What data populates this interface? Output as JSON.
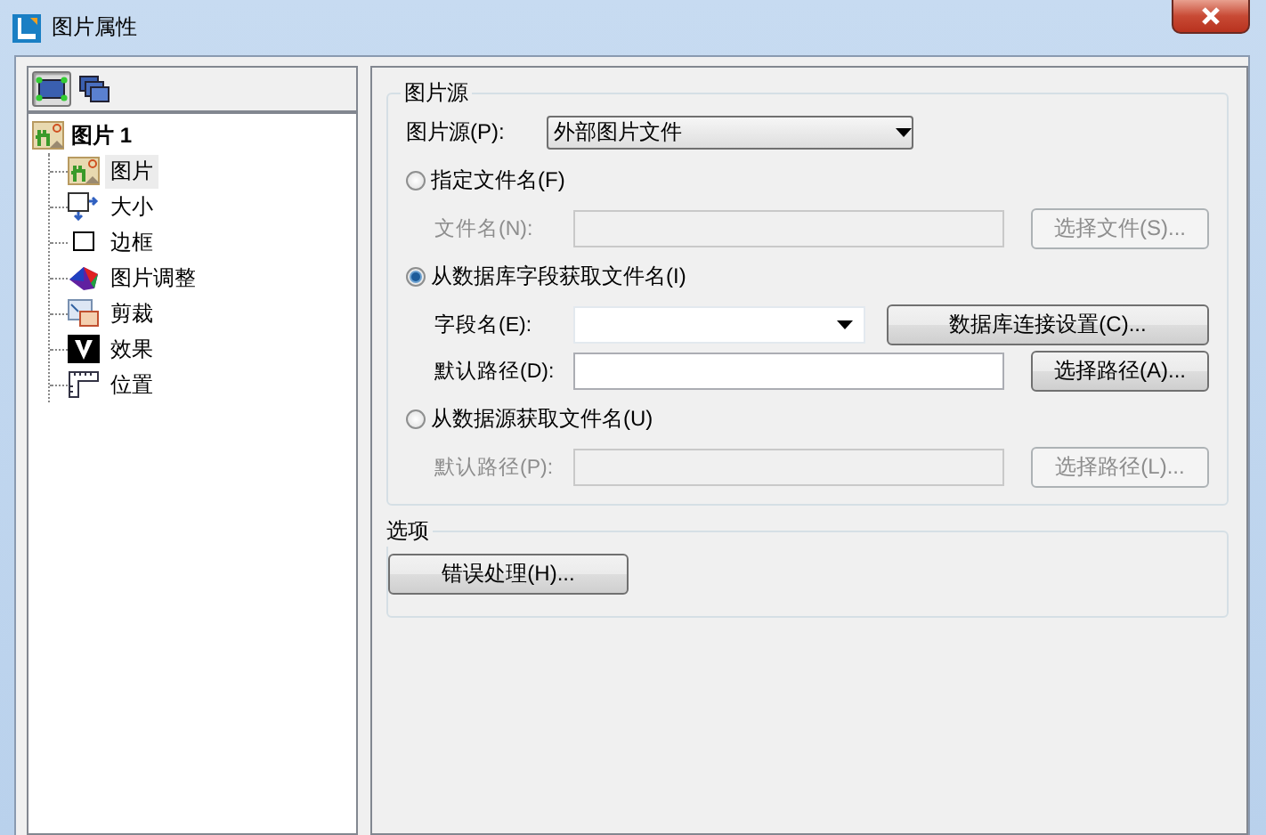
{
  "window": {
    "title": "图片属性"
  },
  "view_buttons": [
    {
      "selected": true
    },
    {
      "selected": false
    }
  ],
  "tree": {
    "label": "图片 1",
    "children": [
      {
        "label": "图片",
        "kind": "picture",
        "selected": true
      },
      {
        "label": "大小",
        "kind": "size",
        "selected": false
      },
      {
        "label": "边框",
        "kind": "border",
        "selected": false
      },
      {
        "label": "图片调整",
        "kind": "adjust",
        "selected": false
      },
      {
        "label": "剪裁",
        "kind": "crop",
        "selected": false
      },
      {
        "label": "效果",
        "kind": "effect",
        "selected": false
      },
      {
        "label": "位置",
        "kind": "position",
        "selected": false
      }
    ]
  },
  "source_group": {
    "title": "图片源",
    "source_label": "图片源(P):",
    "source_value": "外部图片文件",
    "options": [
      {
        "label": "指定文件名(F)",
        "selected": false,
        "rows": [
          {
            "label": "文件名(N):",
            "kind": "text",
            "disabled": true,
            "button": "选择文件(S)..."
          }
        ]
      },
      {
        "label": "从数据库字段获取文件名(I)",
        "selected": true,
        "rows": [
          {
            "label": "字段名(E):",
            "kind": "combo",
            "disabled": false,
            "button": "数据库连接设置(C)..."
          },
          {
            "label": "默认路径(D):",
            "kind": "text",
            "disabled": false,
            "button": "选择路径(A)..."
          }
        ]
      },
      {
        "label": "从数据源获取文件名(U)",
        "selected": false,
        "rows": [
          {
            "label": "默认路径(P):",
            "kind": "text",
            "disabled": true,
            "button": "选择路径(L)..."
          }
        ]
      }
    ]
  },
  "options_group": {
    "title": "选项",
    "button": "错误处理(H)..."
  }
}
